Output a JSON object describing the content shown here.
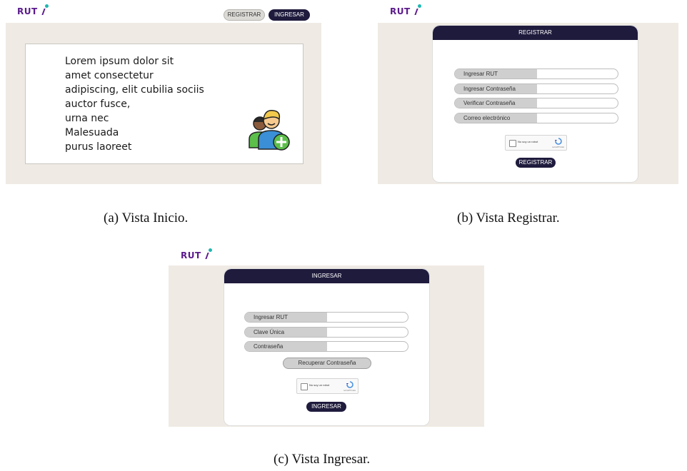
{
  "brand": {
    "logo_text": "RUT"
  },
  "view_a": {
    "register_button": "REGISTRAR",
    "login_button": "INGRESAR",
    "hero_text_lines": [
      "Lorem ipsum dolor sit",
      "amet consectetur",
      "adipiscing, elit cubilia sociis",
      "auctor fusce,",
      "urna nec",
      "Malesuada",
      "purus laoreet"
    ],
    "icon": "add-user-icon",
    "caption": "(a)  Vista Inicio."
  },
  "view_b": {
    "header_title": "REGISTRAR",
    "fields": [
      {
        "label": "Ingresar RUT",
        "value": ""
      },
      {
        "label": "Ingresar Contraseña",
        "value": ""
      },
      {
        "label": "Verificar Contraseña",
        "value": ""
      },
      {
        "label": "Correo electrónico",
        "value": ""
      }
    ],
    "captcha_text": "No soy un robot",
    "captcha_brand": "reCAPTCHA",
    "captcha_sub": "Privacidad - Términos",
    "submit_button": "REGISTRAR",
    "caption": "(b)  Vista Registrar."
  },
  "view_c": {
    "header_title": "INGRESAR",
    "fields": [
      {
        "label": "Ingresar RUT",
        "value": ""
      },
      {
        "label": "Clave Única",
        "value": ""
      },
      {
        "label": "Contraseña",
        "value": ""
      }
    ],
    "recover_button": "Recuperar Contraseña",
    "captcha_text": "No soy un robot",
    "captcha_brand": "reCAPTCHA",
    "captcha_sub": "Privacidad - Términos",
    "submit_button": "INGRESAR",
    "caption": "(c)  Vista Ingresar."
  },
  "colors": {
    "accent_dark": "#1f1b3d",
    "logo_purple": "#5b1a8c",
    "logo_dot": "#1fb7b0",
    "background_beige": "#efebe4"
  }
}
